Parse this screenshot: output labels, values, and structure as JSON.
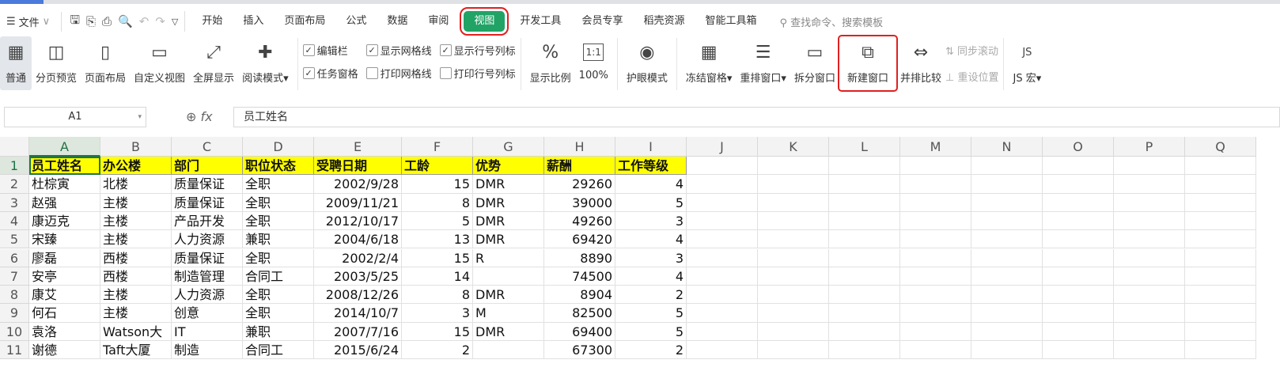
{
  "menu": {
    "icon": "hamburger-icon",
    "file": "文件"
  },
  "tabs": [
    "开始",
    "插入",
    "页面布局",
    "公式",
    "数据",
    "审阅",
    "视图",
    "开发工具",
    "会员专享",
    "稻壳资源",
    "智能工具箱"
  ],
  "active_tab": "视图",
  "search_placeholder": "查找命令、搜索模板",
  "ribbon": {
    "views": [
      "普通",
      "分页预览",
      "页面布局",
      "自定义视图",
      "全屏显示",
      "阅读模式"
    ],
    "checks": [
      {
        "label": "编辑栏",
        "checked": true
      },
      {
        "label": "显示网格线",
        "checked": true
      },
      {
        "label": "显示行号列标",
        "checked": true
      },
      {
        "label": "任务窗格",
        "checked": true
      },
      {
        "label": "打印网格线",
        "checked": false
      },
      {
        "label": "打印行号列标",
        "checked": false
      }
    ],
    "zoom": [
      "显示比例",
      "100%"
    ],
    "eye": "护眼模式",
    "window": [
      "冻结窗格",
      "重排窗口",
      "拆分窗口",
      "新建窗口",
      "并排比较"
    ],
    "sync": [
      "同步滚动",
      "重设位置"
    ],
    "macro": "JS 宏"
  },
  "formula_bar": {
    "cell_ref": "A1",
    "fx": "fx",
    "value": "员工姓名"
  },
  "columns": [
    "A",
    "B",
    "C",
    "D",
    "E",
    "F",
    "G",
    "H",
    "I",
    "J",
    "K",
    "L",
    "M",
    "N",
    "O",
    "P",
    "Q"
  ],
  "rows": [
    [
      "员工姓名",
      "办公楼",
      "部门",
      "职位状态",
      "受聘日期",
      "工龄",
      "优势",
      "薪酬",
      "工作等级"
    ],
    [
      "杜棕寅",
      "北楼",
      "质量保证",
      "全职",
      "2002/9/28",
      "15",
      "DMR",
      "29260",
      "4"
    ],
    [
      "赵强",
      "主楼",
      "质量保证",
      "全职",
      "2009/11/21",
      "8",
      "DMR",
      "39000",
      "5"
    ],
    [
      "康迈克",
      "主楼",
      "产品开发",
      "全职",
      "2012/10/17",
      "5",
      "DMR",
      "49260",
      "3"
    ],
    [
      "宋臻",
      "主楼",
      "人力资源",
      "兼职",
      "2004/6/18",
      "13",
      "DMR",
      "69420",
      "4"
    ],
    [
      "廖磊",
      "西楼",
      "质量保证",
      "全职",
      "2002/2/4",
      "15",
      "R",
      "8890",
      "3"
    ],
    [
      "安亭",
      "西楼",
      "制造管理",
      "合同工",
      "2003/5/25",
      "14",
      "",
      "74500",
      "4"
    ],
    [
      "康艾",
      "主楼",
      "人力资源",
      "全职",
      "2008/12/26",
      "8",
      "DMR",
      "8904",
      "2"
    ],
    [
      "何石",
      "主楼",
      "创意",
      "全职",
      "2014/10/7",
      "3",
      "M",
      "82500",
      "5"
    ],
    [
      "袁洛",
      "Watson大",
      "IT",
      "兼职",
      "2007/7/16",
      "15",
      "DMR",
      "69400",
      "5"
    ],
    [
      "谢德",
      "Taft大厦",
      "制造",
      "合同工",
      "2015/6/24",
      "2",
      "",
      "67300",
      "2"
    ]
  ]
}
